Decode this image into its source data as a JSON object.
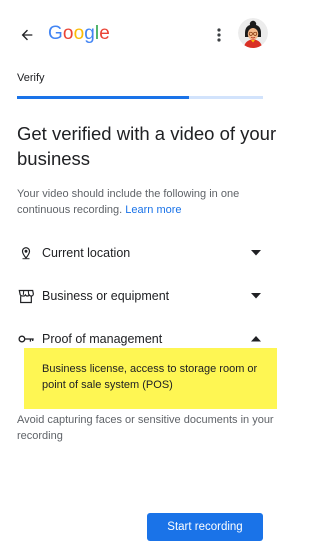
{
  "app": {
    "logo_letters": [
      {
        "char": "G",
        "color": "#4285F4"
      },
      {
        "char": "o",
        "color": "#EA4335"
      },
      {
        "char": "o",
        "color": "#FBBC05"
      },
      {
        "char": "g",
        "color": "#4285F4"
      },
      {
        "char": "l",
        "color": "#34A853"
      },
      {
        "char": "e",
        "color": "#EA4335"
      }
    ]
  },
  "header": {
    "back_icon": "arrow-left-icon",
    "menu_icon": "more-vert-icon",
    "avatar_icon": "user-avatar"
  },
  "step": {
    "label": "Verify",
    "progress": 0.7
  },
  "main": {
    "title": "Get verified with a video of your business",
    "description": "Your video should include the following in one continuous recording.",
    "learn_more": "Learn more",
    "items": [
      {
        "label": "Current location",
        "icon": "location-pin-icon",
        "expanded": false
      },
      {
        "label": "Business or equipment",
        "icon": "storefront-icon",
        "expanded": false
      },
      {
        "label": "Proof of management",
        "icon": "key-icon",
        "expanded": true
      }
    ],
    "expanded_detail": "Business license, access to storage room or point of sale system (POS)",
    "note": "Avoid capturing faces or sensitive documents in your recording"
  },
  "footer": {
    "primary_button": "Start recording"
  },
  "colors": {
    "accent": "#1a73e8",
    "highlight": "#fef653"
  }
}
